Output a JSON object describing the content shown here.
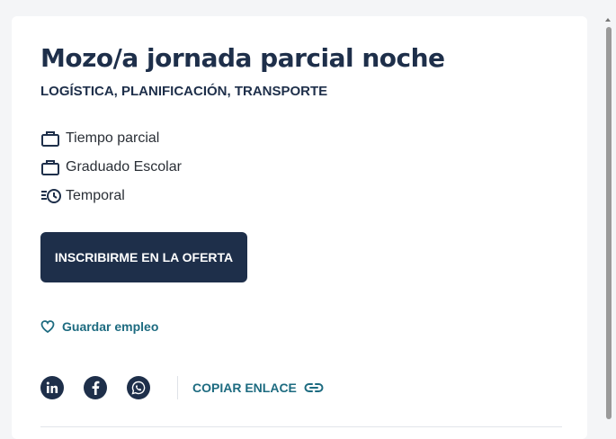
{
  "job": {
    "title": "Mozo/a jornada parcial noche",
    "category": "LOGÍSTICA, PLANIFICACIÓN, TRANSPORTE",
    "attributes": [
      {
        "icon": "briefcase-icon",
        "label": "Tiempo parcial"
      },
      {
        "icon": "briefcase-icon",
        "label": "Graduado Escolar"
      },
      {
        "icon": "clock-list-icon",
        "label": "Temporal"
      }
    ]
  },
  "actions": {
    "apply_label": "INSCRIBIRME EN LA OFERTA",
    "save_label": "Guardar empleo",
    "copy_link_label": "COPIAR ENLACE"
  },
  "share": {
    "networks": [
      "linkedin-icon",
      "facebook-icon",
      "whatsapp-icon"
    ]
  },
  "colors": {
    "primary": "#1e2f4a",
    "link": "#1d6b80",
    "background": "#f4f5f7"
  }
}
